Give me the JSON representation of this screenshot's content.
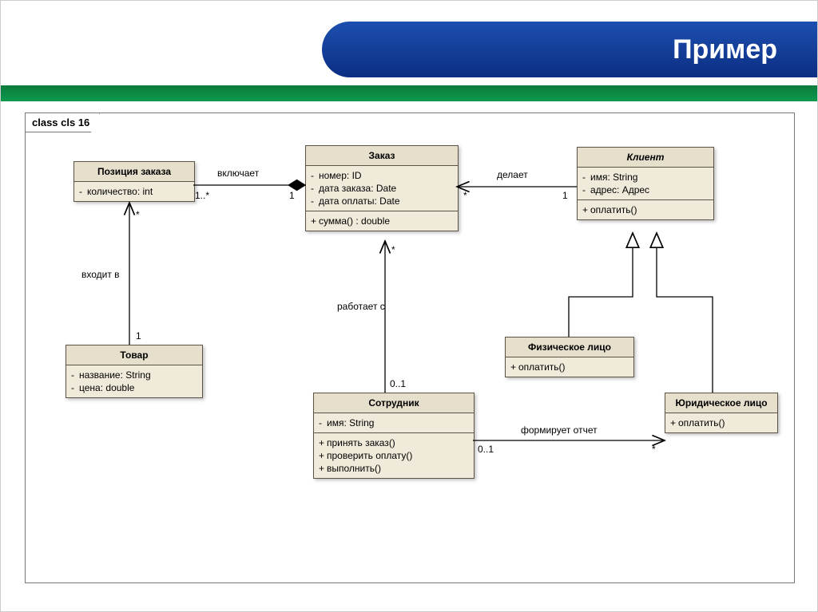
{
  "slide_title": "Пример",
  "frame_label": "class cls 16",
  "classes": {
    "orderItem": {
      "name": "Позиция заказа",
      "attrs": [
        {
          "vis": "-",
          "name": "количество",
          "type": "int"
        }
      ]
    },
    "order": {
      "name": "Заказ",
      "attrs": [
        {
          "vis": "-",
          "name": "номер",
          "type": "ID"
        },
        {
          "vis": "-",
          "name": "дата заказа",
          "type": "Date"
        },
        {
          "vis": "-",
          "name": "дата оплаты",
          "type": "Date"
        }
      ],
      "ops": [
        {
          "vis": "+",
          "sig": "сумма() : double"
        }
      ]
    },
    "client": {
      "name": "Клиент",
      "attrs": [
        {
          "vis": "-",
          "name": "имя",
          "type": "String"
        },
        {
          "vis": "-",
          "name": "адрес",
          "type": "Адрес"
        }
      ],
      "ops": [
        {
          "vis": "+",
          "sig": "оплатить()"
        }
      ]
    },
    "product": {
      "name": "Товар",
      "attrs": [
        {
          "vis": "-",
          "name": "название",
          "type": "String"
        },
        {
          "vis": "-",
          "name": "цена",
          "type": "double"
        }
      ]
    },
    "employee": {
      "name": "Сотрудник",
      "attrs": [
        {
          "vis": "-",
          "name": "имя",
          "type": "String"
        }
      ],
      "ops": [
        {
          "vis": "+",
          "sig": "принять заказ()"
        },
        {
          "vis": "+",
          "sig": "проверить оплату()"
        },
        {
          "vis": "+",
          "sig": "выполнить()"
        }
      ]
    },
    "person": {
      "name": "Физическое лицо",
      "ops": [
        {
          "vis": "+",
          "sig": "оплатить()"
        }
      ]
    },
    "company": {
      "name": "Юридическое лицо",
      "ops": [
        {
          "vis": "+",
          "sig": "оплатить()"
        }
      ]
    }
  },
  "relations": {
    "includes": {
      "label": "включает",
      "end1": "1..*",
      "end2": "1"
    },
    "makes": {
      "label": "делает",
      "end1": "*",
      "end2": "1"
    },
    "contains": {
      "label": "входит в",
      "end1": "*",
      "end2": "1"
    },
    "worksWith": {
      "label": "работает с",
      "end1": "*",
      "end2": "0..1"
    },
    "reports": {
      "label": "формирует отчет",
      "end1": "0..1",
      "end2": "*"
    }
  }
}
